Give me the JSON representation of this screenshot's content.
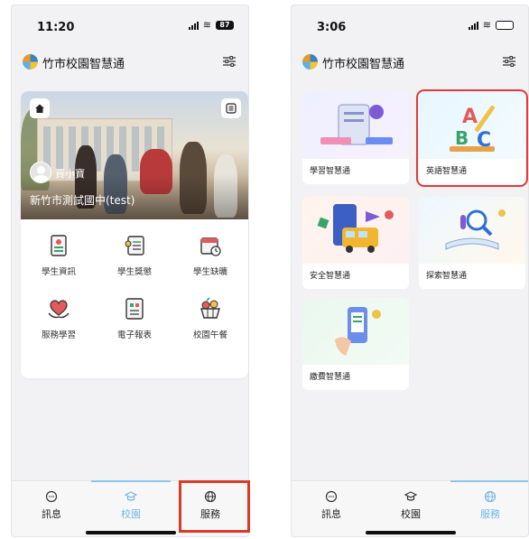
{
  "left_screen": {
    "status": {
      "time": "11:20",
      "battery": "87"
    },
    "header": {
      "title": "竹市校園智慧通"
    },
    "user": {
      "name": "賈小寶",
      "school": "新竹市測試國中(test)"
    },
    "menu": [
      {
        "label": "學生資訊",
        "icon": "student-info-icon"
      },
      {
        "label": "學生獎懲",
        "icon": "reward-punish-icon"
      },
      {
        "label": "學生缺曠",
        "icon": "absence-calendar-icon"
      },
      {
        "label": "服務學習",
        "icon": "service-heart-icon"
      },
      {
        "label": "電子報表",
        "icon": "report-icon"
      },
      {
        "label": "校園午餐",
        "icon": "lunch-basket-icon"
      }
    ],
    "nav": [
      {
        "label": "訊息",
        "icon": "message-icon"
      },
      {
        "label": "校園",
        "icon": "campus-icon",
        "active": true
      },
      {
        "label": "服務",
        "icon": "globe-icon"
      }
    ]
  },
  "right_screen": {
    "status": {
      "time": "3:06"
    },
    "header": {
      "title": "竹市校園智慧通"
    },
    "tiles": [
      {
        "label": "學習智慧通"
      },
      {
        "label": "英語智慧通",
        "highlighted": true
      },
      {
        "label": "安全智慧通"
      },
      {
        "label": "探索智慧通"
      },
      {
        "label": "繳費智慧通"
      }
    ],
    "nav": [
      {
        "label": "訊息",
        "icon": "message-icon"
      },
      {
        "label": "校園",
        "icon": "campus-icon"
      },
      {
        "label": "服務",
        "icon": "globe-icon",
        "active": true
      }
    ]
  },
  "colors": {
    "accent": "#6fb7e4",
    "highlight": "#d93b2b",
    "background": "#f2f2f4"
  }
}
